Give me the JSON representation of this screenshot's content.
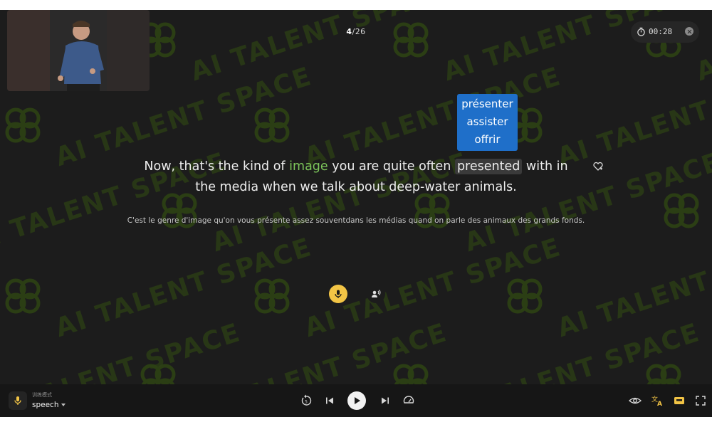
{
  "progress": {
    "current": "4",
    "separator": "/",
    "total": "26"
  },
  "timer": {
    "value": "00:28"
  },
  "watermark": {
    "text": "AI TALENT SPACE"
  },
  "popup": {
    "options": [
      "présenter",
      "assister",
      "offrir"
    ]
  },
  "sentence": {
    "line1_pre": "Now, that's the kind of ",
    "line1_green": "image",
    "line1_mid": " you are quite often ",
    "line1_box": "presented",
    "line1_post": " with in",
    "line2": "the media when we talk about deep-water animals."
  },
  "translation": "C'est le genre d'image qu'on vous présente assez souventdans les médias quand on parle des animaux des grands fonds.",
  "mode": {
    "label": "训练模式",
    "value": "speech"
  },
  "colors": {
    "accent_yellow": "#f2c445",
    "popup_blue": "#1f6fc9",
    "highlight_green": "#7cc55a",
    "background": "#1c1c1c"
  },
  "icons": {
    "top": [
      "timer-icon",
      "close-icon"
    ],
    "center": [
      "mic-icon",
      "speaker-person-icon",
      "favorite-heart-icon"
    ],
    "bottom_left": [
      "microphone-mode-icon"
    ],
    "bottom_center": [
      "replay-icon",
      "previous-icon",
      "play-icon",
      "next-icon",
      "speed-icon"
    ],
    "bottom_right": [
      "eye-icon",
      "translate-icon",
      "subtitle-icon",
      "fullscreen-icon"
    ]
  }
}
